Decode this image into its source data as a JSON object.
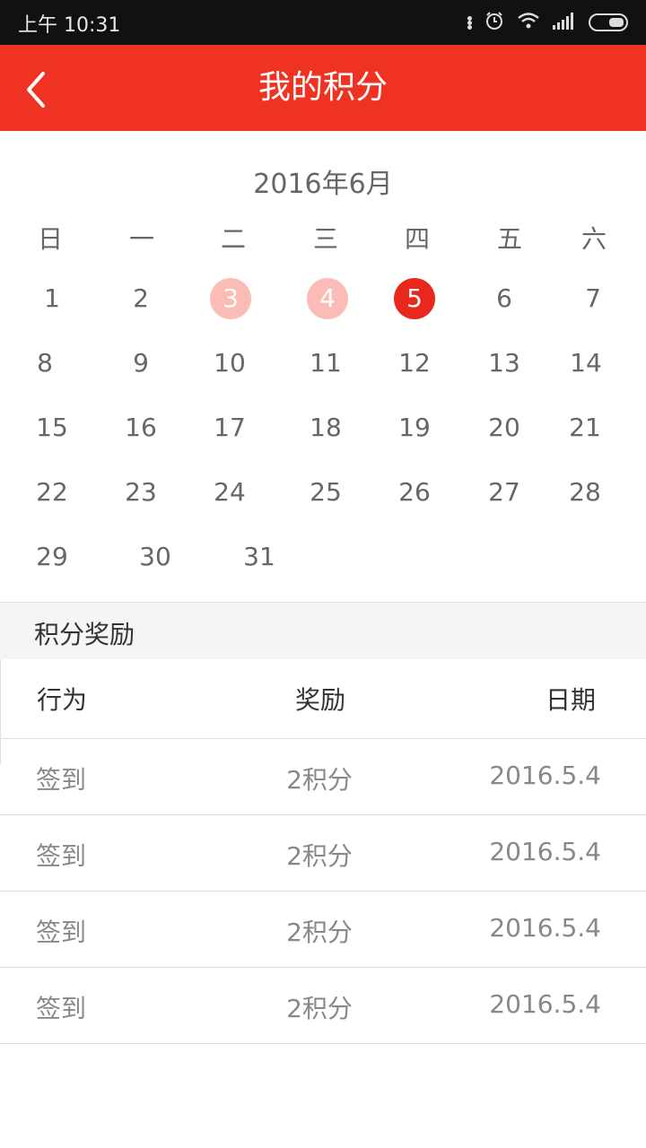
{
  "status_bar": {
    "time": "上午 10:31",
    "icons": [
      "more-dots-icon",
      "alarm-icon",
      "wifi-icon",
      "signal-icon",
      "battery-icon"
    ]
  },
  "header": {
    "title": "我的积分",
    "back_icon": "chevron-left-icon",
    "background": "#f03223"
  },
  "calendar": {
    "month_title": "2016年6月",
    "weekdays": [
      "日",
      "一",
      "二",
      "三",
      "四",
      "五",
      "六"
    ],
    "days": [
      "1",
      "2",
      "3",
      "4",
      "5",
      "6",
      "7",
      "8",
      "9",
      "10",
      "11",
      "12",
      "13",
      "14",
      "15",
      "16",
      "17",
      "18",
      "19",
      "20",
      "21",
      "22",
      "23",
      "24",
      "25",
      "26",
      "27",
      "28",
      "29",
      "30",
      "31"
    ],
    "signed_days": [
      "3",
      "4"
    ],
    "today": "5",
    "signed_color": "#fbbcb5",
    "today_color": "#e8281c"
  },
  "rewards": {
    "section_title": "积分奖励",
    "columns": [
      "行为",
      "奖励",
      "日期"
    ],
    "rows": [
      [
        "签到",
        "2积分",
        "2016.5.4"
      ],
      [
        "签到",
        "2积分",
        "2016.5.4"
      ],
      [
        "签到",
        "2积分",
        "2016.5.4"
      ],
      [
        "签到",
        "2积分",
        "2016.5.4"
      ]
    ]
  }
}
